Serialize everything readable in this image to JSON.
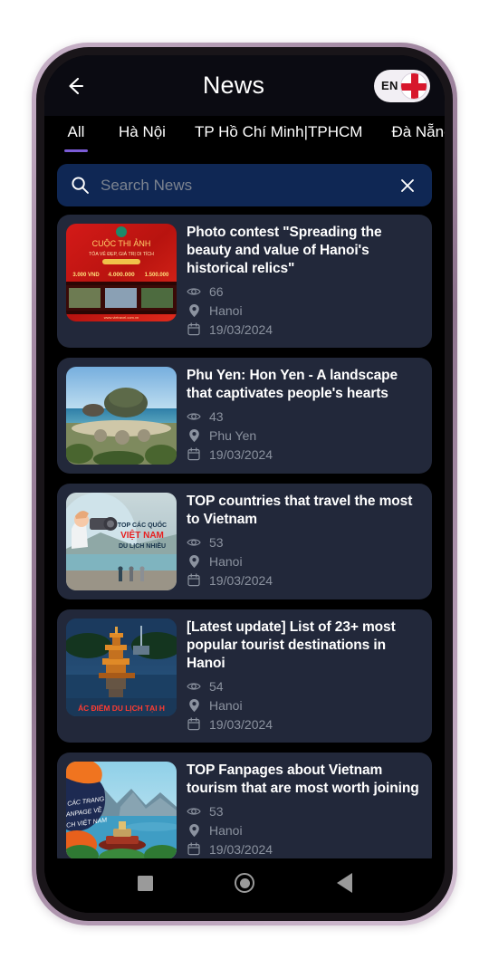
{
  "header": {
    "title": "News",
    "back_icon": "back-arrow-icon",
    "language": {
      "code": "EN",
      "flag": "england-flag-icon",
      "flag_colors": {
        "cross": "#d7172c",
        "field": "#ffffff"
      }
    }
  },
  "tabs": {
    "active_index": 0,
    "items": [
      {
        "label": "All"
      },
      {
        "label": "Hà Nội"
      },
      {
        "label": "TP Hồ Chí Minh|TPHCM"
      },
      {
        "label": "Đà Nẵng"
      }
    ],
    "indicator_color": "#7b5cd6"
  },
  "search": {
    "placeholder": "Search News",
    "value": "",
    "search_icon": "search-icon",
    "clear_icon": "close-icon",
    "background": "#0f2754"
  },
  "news": {
    "items": [
      {
        "title": "Photo contest \"Spreading the beauty and value of Hanoi's historical relics\"",
        "views": "66",
        "location": "Hanoi",
        "date": "19/03/2024",
        "thumbnail": "photo-contest-red-poster-thumbnail"
      },
      {
        "title": "Phu Yen: Hon Yen - A landscape that captivates people's hearts",
        "views": "43",
        "location": "Phu Yen",
        "date": "19/03/2024",
        "thumbnail": "hon-yen-island-seascape-thumbnail"
      },
      {
        "title": "TOP countries that travel the most to Vietnam",
        "views": "53",
        "location": "Hanoi",
        "date": "19/03/2024",
        "thumbnail": "photographer-illustration-thumbnail"
      },
      {
        "title": "[Latest update] List of 23+ most popular tourist destinations in Hanoi",
        "views": "54",
        "location": "Hanoi",
        "date": "19/03/2024",
        "thumbnail": "turtle-tower-night-thumbnail"
      },
      {
        "title": "TOP Fanpages about Vietnam tourism that are most worth joining",
        "views": "53",
        "location": "Hanoi",
        "date": "19/03/2024",
        "thumbnail": "halong-bay-fanpage-thumbnail"
      }
    ],
    "icons": {
      "views": "eye-icon",
      "location": "location-pin-icon",
      "date": "calendar-icon"
    },
    "card_background": "#22283a"
  },
  "system_nav": {
    "recents": "square-recents-icon",
    "home": "circle-home-icon",
    "back": "triangle-back-icon"
  }
}
